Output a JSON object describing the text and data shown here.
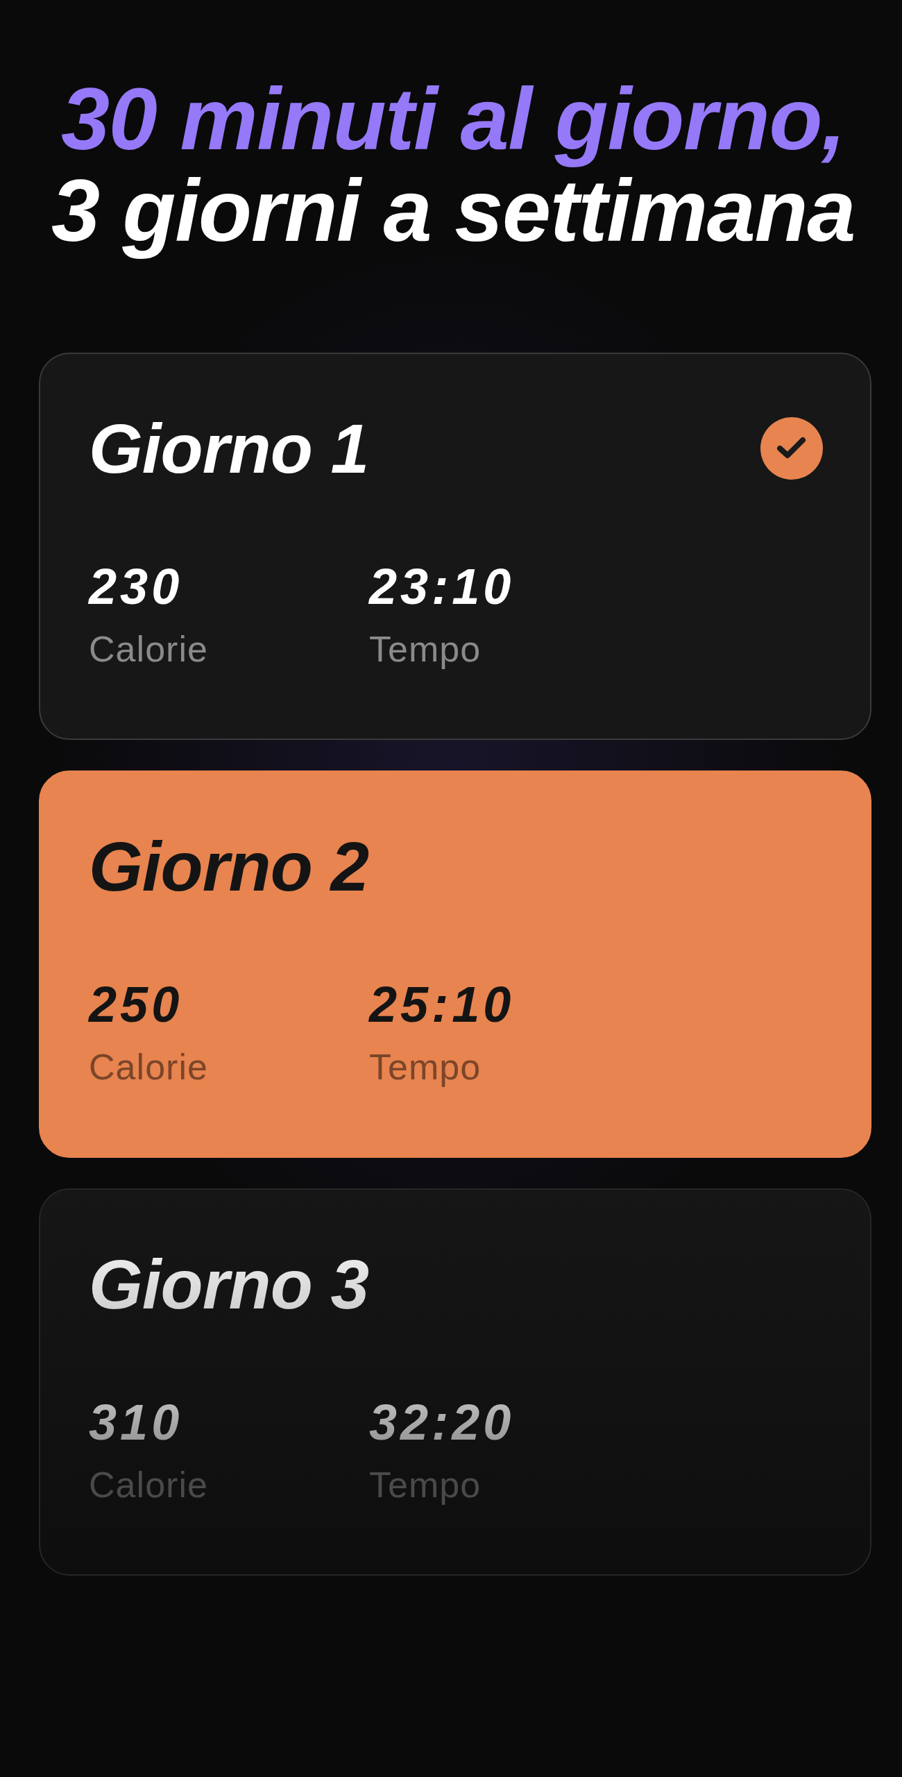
{
  "headline": [
    {
      "text": "30 minuti al giorno,",
      "highlighted": true
    },
    {
      "text": "3 giorni a settimana",
      "highlighted": false
    }
  ],
  "days": [
    {
      "title": "Giorno 1",
      "selected": false,
      "completed": true,
      "disabled": false,
      "stats": [
        {
          "value": "230",
          "label": "Calorie"
        },
        {
          "value": "23:10",
          "label": "Tempo"
        }
      ]
    },
    {
      "title": "Giorno 2",
      "selected": true,
      "completed": false,
      "disabled": false,
      "stats": [
        {
          "value": "250",
          "label": "Calorie"
        },
        {
          "value": "25:10",
          "label": "Tempo"
        }
      ]
    },
    {
      "title": "Giorno 3",
      "selected": false,
      "completed": false,
      "disabled": true,
      "stats": [
        {
          "value": "310",
          "label": "Calorie"
        },
        {
          "value": "32:20",
          "label": "Tempo"
        }
      ]
    }
  ]
}
